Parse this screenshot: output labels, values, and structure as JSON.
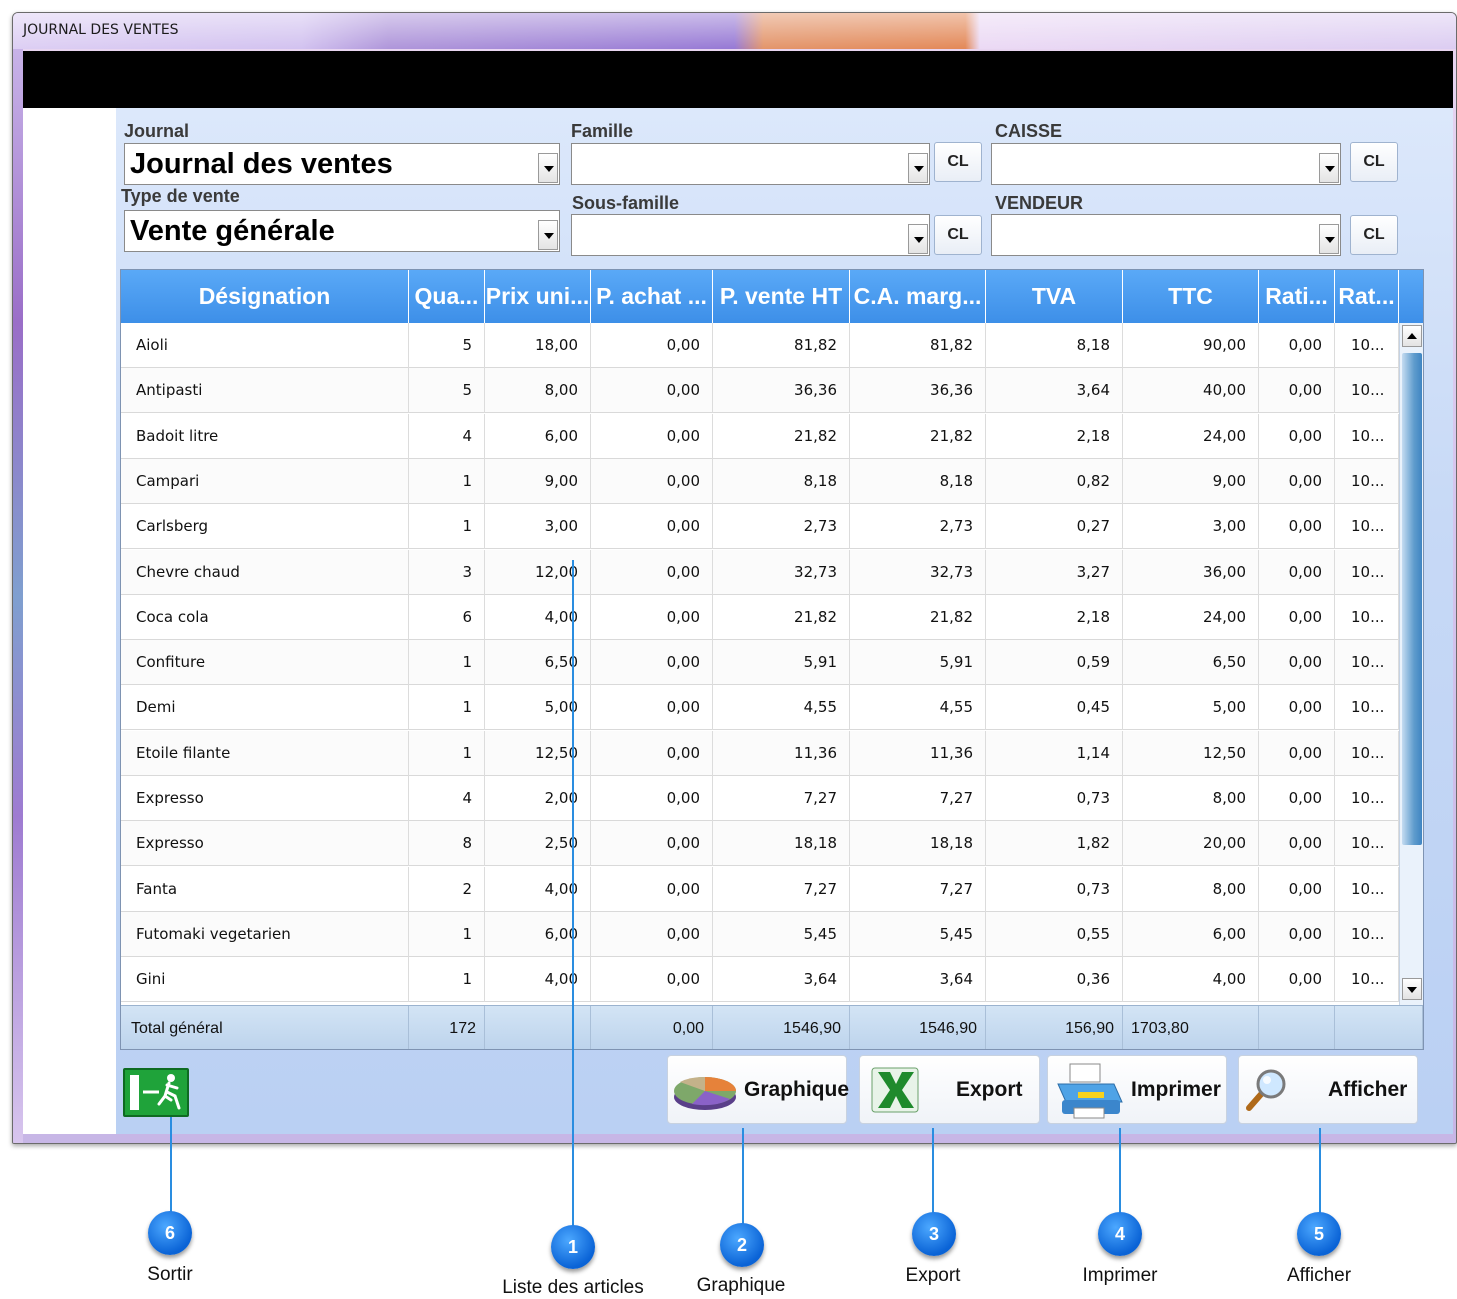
{
  "window": {
    "title": "JOURNAL DES VENTES"
  },
  "filters": {
    "journal": {
      "label": "Journal",
      "value": "Journal des ventes"
    },
    "type_vente": {
      "label": "Type de vente",
      "value": "Vente générale"
    },
    "famille": {
      "label": "Famille",
      "value": "",
      "clear_label": "CL"
    },
    "sous_famille": {
      "label": "Sous-famille",
      "value": "",
      "clear_label": "CL"
    },
    "caisse": {
      "label": "CAISSE",
      "value": "",
      "clear_label": "CL"
    },
    "vendeur": {
      "label": "VENDEUR",
      "value": "",
      "clear_label": "CL"
    }
  },
  "grid": {
    "columns": [
      "Désignation",
      "Qua...",
      "Prix uni...",
      "P. achat ...",
      "P. vente HT",
      "C.A. marg...",
      "TVA",
      "TTC",
      "Rati...",
      "Rat..."
    ],
    "rows": [
      [
        "Aioli",
        "5",
        "18,00",
        "0,00",
        "81,82",
        "81,82",
        "8,18",
        "90,00",
        "0,00",
        "10..."
      ],
      [
        "Antipasti",
        "5",
        "8,00",
        "0,00",
        "36,36",
        "36,36",
        "3,64",
        "40,00",
        "0,00",
        "10..."
      ],
      [
        "Badoit litre",
        "4",
        "6,00",
        "0,00",
        "21,82",
        "21,82",
        "2,18",
        "24,00",
        "0,00",
        "10..."
      ],
      [
        "Campari",
        "1",
        "9,00",
        "0,00",
        "8,18",
        "8,18",
        "0,82",
        "9,00",
        "0,00",
        "10..."
      ],
      [
        "Carlsberg",
        "1",
        "3,00",
        "0,00",
        "2,73",
        "2,73",
        "0,27",
        "3,00",
        "0,00",
        "10..."
      ],
      [
        "Chevre chaud",
        "3",
        "12,00",
        "0,00",
        "32,73",
        "32,73",
        "3,27",
        "36,00",
        "0,00",
        "10..."
      ],
      [
        "Coca cola",
        "6",
        "4,00",
        "0,00",
        "21,82",
        "21,82",
        "2,18",
        "24,00",
        "0,00",
        "10..."
      ],
      [
        "Confiture",
        "1",
        "6,50",
        "0,00",
        "5,91",
        "5,91",
        "0,59",
        "6,50",
        "0,00",
        "10..."
      ],
      [
        "Demi",
        "1",
        "5,00",
        "0,00",
        "4,55",
        "4,55",
        "0,45",
        "5,00",
        "0,00",
        "10..."
      ],
      [
        "Etoile filante",
        "1",
        "12,50",
        "0,00",
        "11,36",
        "11,36",
        "1,14",
        "12,50",
        "0,00",
        "10..."
      ],
      [
        "Expresso",
        "4",
        "2,00",
        "0,00",
        "7,27",
        "7,27",
        "0,73",
        "8,00",
        "0,00",
        "10..."
      ],
      [
        "Expresso",
        "8",
        "2,50",
        "0,00",
        "18,18",
        "18,18",
        "1,82",
        "20,00",
        "0,00",
        "10..."
      ],
      [
        "Fanta",
        "2",
        "4,00",
        "0,00",
        "7,27",
        "7,27",
        "0,73",
        "8,00",
        "0,00",
        "10..."
      ],
      [
        "Futomaki vegetarien",
        "1",
        "6,00",
        "0,00",
        "5,45",
        "5,45",
        "0,55",
        "6,00",
        "0,00",
        "10..."
      ],
      [
        "Gini",
        "1",
        "4,00",
        "0,00",
        "3,64",
        "3,64",
        "0,36",
        "4,00",
        "0,00",
        "10..."
      ]
    ],
    "totals": [
      "Total général",
      "172",
      "",
      "0,00",
      "1546,90",
      "1546,90",
      "156,90",
      "1703,80",
      "",
      ""
    ]
  },
  "actions": {
    "graphique": {
      "label": "Graphique",
      "icon": "pie-chart-icon"
    },
    "export": {
      "label": "Export",
      "icon": "excel-icon"
    },
    "imprimer": {
      "label": "Imprimer",
      "icon": "printer-icon"
    },
    "afficher": {
      "label": "Afficher",
      "icon": "magnifier-icon"
    },
    "sortir": {
      "icon": "exit-icon"
    }
  },
  "callouts": [
    {
      "number": "1",
      "label": "Liste des articles"
    },
    {
      "number": "2",
      "label": "Graphique"
    },
    {
      "number": "3",
      "label": "Export"
    },
    {
      "number": "4",
      "label": "Imprimer"
    },
    {
      "number": "5",
      "label": "Afficher"
    },
    {
      "number": "6",
      "label": "Sortir"
    }
  ],
  "colors": {
    "header_blue": "#3d8fe8",
    "callout_blue": "#0a63d6",
    "exit_green": "#1fa33a"
  }
}
